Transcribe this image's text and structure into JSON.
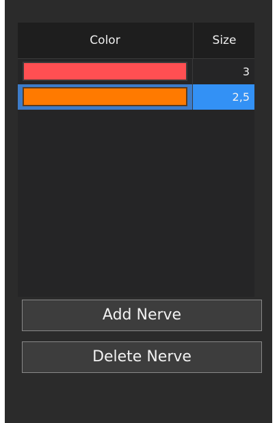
{
  "table": {
    "columns": [
      "Color",
      "Size"
    ],
    "rows": [
      {
        "color": "#ff4f52",
        "size": "3",
        "selected": false
      },
      {
        "color": "#ff7a00",
        "size": "2,5",
        "selected": true
      }
    ]
  },
  "buttons": {
    "add_label": "Add Nerve",
    "delete_label": "Delete Nerve"
  },
  "colors": {
    "panel_bg": "#2b2b2b",
    "selection_bg": "#3391f5"
  }
}
